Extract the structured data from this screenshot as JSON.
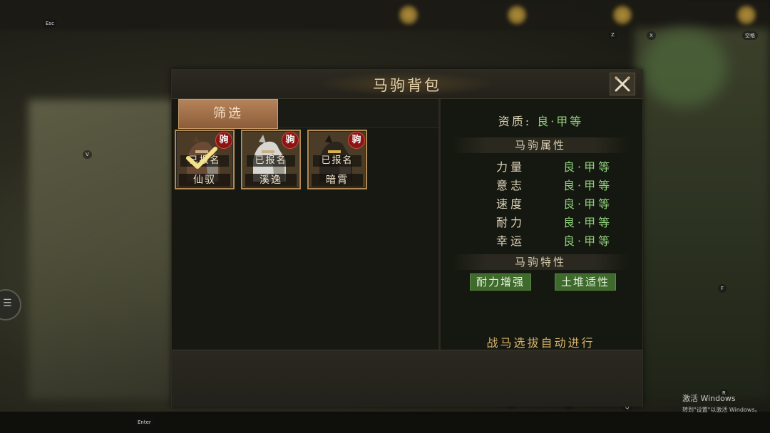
{
  "dialog": {
    "title": "马驹背包",
    "filter_label": "筛选"
  },
  "horses": [
    {
      "name": "仙驭",
      "tag": "已报名",
      "badge": "驹",
      "selected": true,
      "coat": "#6b4a35"
    },
    {
      "name": "溪逸",
      "tag": "已报名",
      "badge": "驹",
      "selected": false,
      "coat": "#d8d6d0"
    },
    {
      "name": "暗霄",
      "tag": "已报名",
      "badge": "驹",
      "selected": false,
      "coat": "#2b241f"
    }
  ],
  "details": {
    "quality_label": "资质:",
    "quality_value": "良·甲等",
    "attributes_title": "马驹属性",
    "attributes": [
      {
        "name": "力量",
        "value": "良·甲等"
      },
      {
        "name": "意志",
        "value": "良·甲等"
      },
      {
        "name": "速度",
        "value": "良·甲等"
      },
      {
        "name": "耐力",
        "value": "良·甲等"
      },
      {
        "name": "幸运",
        "value": "良·甲等"
      }
    ],
    "traits_title": "马驹特性",
    "traits": [
      "耐力增强",
      "土堆适性"
    ],
    "auto_note": "战马选拔自动进行"
  },
  "keys": {
    "esc": "Esc",
    "z": "Z",
    "x": "X",
    "space": "空格",
    "v": "V",
    "f": "F",
    "enter": "Enter",
    "c": "C",
    "b": "B",
    "q": "Q",
    "r": "R"
  },
  "watermark": {
    "line1": "激活 Windows",
    "line2": "转到\"设置\"以激活 Windows。"
  },
  "colors": {
    "accent_green": "#8fd17c",
    "badge_red": "#8a1515",
    "frame_gold": "#b08a56"
  }
}
